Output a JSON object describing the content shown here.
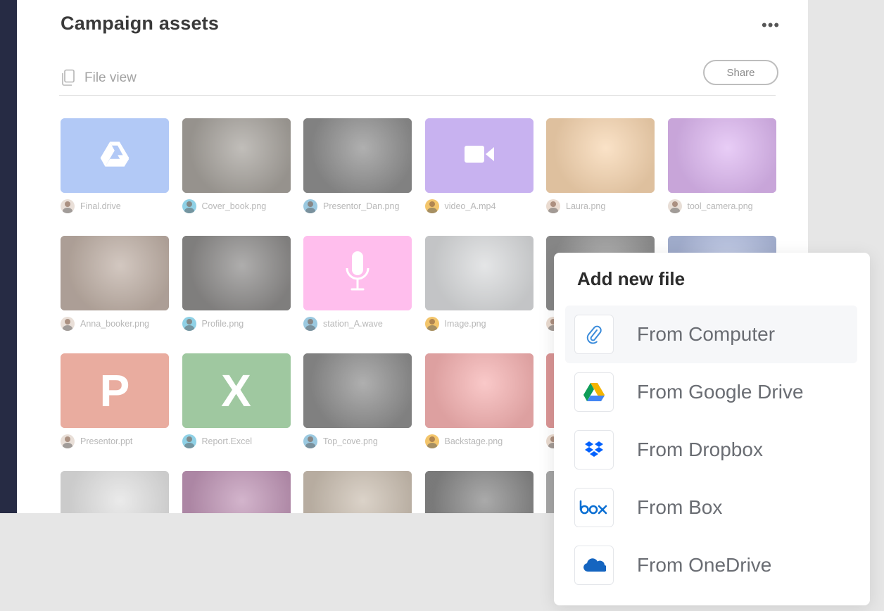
{
  "panel": {
    "title": "Campaign assets",
    "more_label": "•••",
    "view_label": "File view",
    "share_label": "Share"
  },
  "files": [
    {
      "name": "Final.drive",
      "kind": "drive",
      "color": "#7aa3ef"
    },
    {
      "name": "Cover_book.png",
      "kind": "photo",
      "color": "#5b5348"
    },
    {
      "name": "Presentor_Dan.png",
      "kind": "photo",
      "color": "#2e2e2e"
    },
    {
      "name": "video_A.mp4",
      "kind": "video",
      "color": "#a07ae6"
    },
    {
      "name": "Laura.png",
      "kind": "photo",
      "color": "#f2b36c"
    },
    {
      "name": "tool_camera.png",
      "kind": "photo",
      "color": "#c37be8"
    },
    {
      "name": "Anna_booker.png",
      "kind": "photo",
      "color": "#8a6d5a"
    },
    {
      "name": "Profile.png",
      "kind": "photo",
      "color": "#2b2826"
    },
    {
      "name": "station_A.wave",
      "kind": "audio",
      "color": "#ff8fe0"
    },
    {
      "name": "Image.png",
      "kind": "photo",
      "color": "#b9bcbf"
    },
    {
      "name": "",
      "kind": "photo",
      "color": "#3a3a3a"
    },
    {
      "name": "",
      "kind": "photo",
      "color": "#6f86c8"
    },
    {
      "name": "Presentor.ppt",
      "kind": "ppt",
      "color": "#d9705a",
      "letter": "P"
    },
    {
      "name": "Report.Excel",
      "kind": "excel",
      "color": "#5aa05c",
      "letter": "X"
    },
    {
      "name": "Top_cove.png",
      "kind": "photo",
      "color": "#2d2d2d"
    },
    {
      "name": "Backstage.png",
      "kind": "photo",
      "color": "#f07070"
    },
    {
      "name": "",
      "kind": "photo",
      "color": "#e65858"
    },
    {
      "name": "",
      "kind": "photo",
      "color": "#ffffff"
    },
    {
      "name": "",
      "kind": "photo",
      "color": "#c9c9c9"
    },
    {
      "name": "",
      "kind": "photo",
      "color": "#8a3a78"
    },
    {
      "name": "",
      "kind": "photo",
      "color": "#a08a70"
    },
    {
      "name": "",
      "kind": "photo",
      "color": "#1f1f1f"
    },
    {
      "name": "",
      "kind": "photo",
      "color": "#777777"
    },
    {
      "name": "",
      "kind": "photo",
      "color": "#ffffff"
    }
  ],
  "popup": {
    "title": "Add new file",
    "options": [
      {
        "label": "From Computer",
        "icon": "paperclip-icon"
      },
      {
        "label": "From Google Drive",
        "icon": "google-drive-icon"
      },
      {
        "label": "From Dropbox",
        "icon": "dropbox-icon"
      },
      {
        "label": "From Box",
        "icon": "box-icon"
      },
      {
        "label": "From OneDrive",
        "icon": "onedrive-icon"
      }
    ]
  }
}
